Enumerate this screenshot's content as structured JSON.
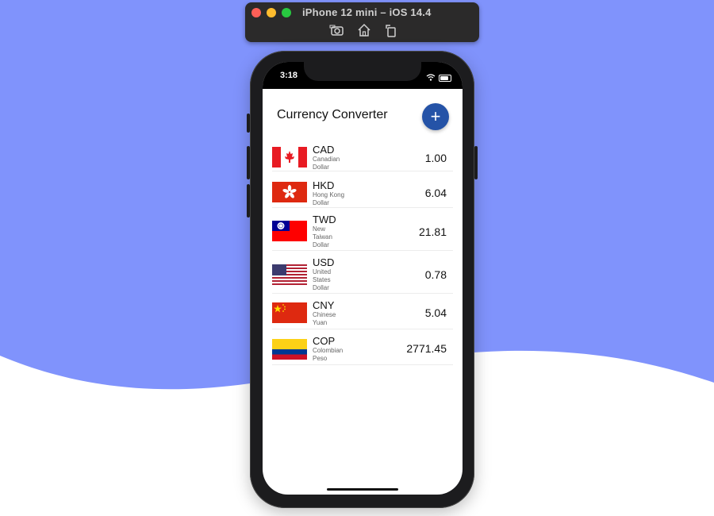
{
  "simulator": {
    "title": "iPhone 12 mini – iOS 14.4",
    "tools": [
      "screenshot-icon",
      "home-icon",
      "rotate-icon"
    ]
  },
  "status_bar": {
    "time": "3:18"
  },
  "app": {
    "title": "Currency Converter",
    "add_label": "+"
  },
  "currencies": [
    {
      "code": "CAD",
      "name": "Canadian Dollar",
      "amount": "1.00",
      "flag": "canada-flag-icon"
    },
    {
      "code": "HKD",
      "name": "Hong Kong Dollar",
      "amount": "6.04",
      "flag": "hong-kong-flag-icon"
    },
    {
      "code": "TWD",
      "name": "New Taiwan Dollar",
      "amount": "21.81",
      "flag": "taiwan-flag-icon"
    },
    {
      "code": "USD",
      "name": "United States Dollar",
      "amount": "0.78",
      "flag": "usa-flag-icon"
    },
    {
      "code": "CNY",
      "name": "Chinese Yuan",
      "amount": "5.04",
      "flag": "china-flag-icon"
    },
    {
      "code": "COP",
      "name": "Colombian Peso",
      "amount": "2771.45",
      "flag": "colombia-flag-icon"
    }
  ],
  "colors": {
    "background": "#8093fc",
    "accent": "#2553a7"
  }
}
